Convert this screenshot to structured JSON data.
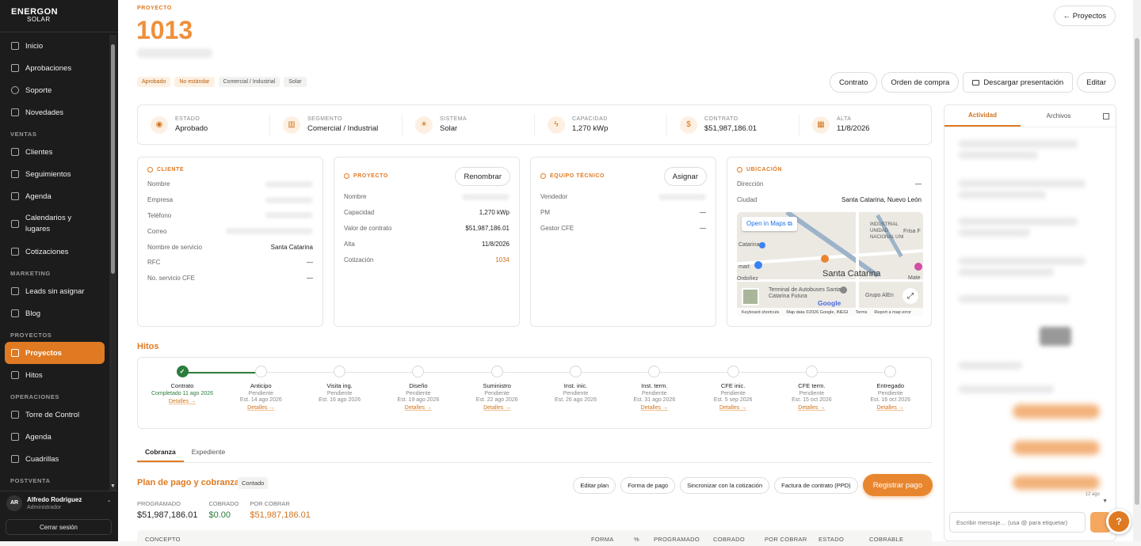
{
  "brand": {
    "name": "ENERGON",
    "sub": "SOLAR"
  },
  "nav": {
    "top": [
      {
        "label": "Inicio",
        "name": "nav-inicio"
      },
      {
        "label": "Aprobaciones",
        "name": "nav-aprobaciones"
      },
      {
        "label": "Soporte",
        "name": "nav-soporte"
      },
      {
        "label": "Novedades",
        "name": "nav-novedades"
      }
    ],
    "sections": {
      "ventas": "VENTAS",
      "marketing": "MARKETING",
      "proyectos": "PROYECTOS",
      "operaciones": "OPERACIONES",
      "postventa": "POSTVENTA"
    },
    "ventas": [
      "Clientes",
      "Seguimientos",
      "Agenda",
      "Calendarios y lugares",
      "Cotizaciones"
    ],
    "marketing": [
      "Leads sin asignar",
      "Blog"
    ],
    "proyectos": [
      "Proyectos",
      "Hitos"
    ],
    "operaciones": [
      "Torre de Control",
      "Agenda",
      "Cuadrillas"
    ]
  },
  "user": {
    "initials": "AR",
    "name": "Alfredo Rodriguez",
    "role": "Administrador",
    "logout": "Cerrar sesión"
  },
  "project": {
    "kicker": "PROYECTO",
    "id": "1013",
    "back": "← Proyectos",
    "tags": [
      "Aprobado",
      "No estándar",
      "Comercial / Industrial",
      "Solar"
    ],
    "actions": {
      "contrato": "Contrato",
      "orden": "Orden de compra",
      "descargar": "Descargar presentación",
      "editar": "Editar"
    }
  },
  "summary": [
    {
      "label": "ESTADO",
      "value": "Aprobado",
      "icon": "circle-icon"
    },
    {
      "label": "SEGMENTO",
      "value": "Comercial / Industrial",
      "icon": "building-icon"
    },
    {
      "label": "SISTEMA",
      "value": "Solar",
      "icon": "sun-icon"
    },
    {
      "label": "CAPACIDAD",
      "value": "1,270 kWp",
      "icon": "bolt-icon"
    },
    {
      "label": "CONTRATO",
      "value": "$51,987,186.01",
      "icon": "dollar-icon"
    },
    {
      "label": "ALTA",
      "value": "11/8/2026",
      "icon": "calendar-icon"
    }
  ],
  "cliente": {
    "kicker": "CLIENTE",
    "rows": [
      {
        "label": "Nombre",
        "value": ""
      },
      {
        "label": "Empresa",
        "value": ""
      },
      {
        "label": "Teléfono",
        "value": ""
      },
      {
        "label": "Correo",
        "value": ""
      },
      {
        "label": "Nombre de servicio",
        "value": "Santa Catarina"
      },
      {
        "label": "RFC",
        "value": "—"
      },
      {
        "label": "No. servicio CFE",
        "value": "—"
      }
    ]
  },
  "proyecto_card": {
    "kicker": "PROYECTO",
    "button": "Renombrar",
    "rows": [
      {
        "label": "Nombre",
        "value": ""
      },
      {
        "label": "Capacidad",
        "value": "1,270 kWp"
      },
      {
        "label": "Valor de contrato",
        "value": "$51,987,186.01"
      },
      {
        "label": "Alta",
        "value": "11/8/2026"
      },
      {
        "label": "Cotización",
        "value": "1034"
      }
    ]
  },
  "equipo": {
    "kicker": "EQUIPO TÉCNICO",
    "button": "Asignar",
    "rows": [
      {
        "label": "Vendedor",
        "value": ""
      },
      {
        "label": "PM",
        "value": "—"
      },
      {
        "label": "Gestor CFE",
        "value": "—"
      }
    ]
  },
  "ubicacion": {
    "kicker": "UBICACIÓN",
    "rows": [
      {
        "label": "Dirección",
        "value": "—"
      },
      {
        "label": "Ciudad",
        "value": "Santa Catarina, Nuevo León"
      }
    ],
    "map": {
      "open": "Open in Maps",
      "city": "Santa Catarina",
      "labels": [
        "INDUSTRIAL UNIDAD NACIONAL UNI",
        "Frisa F",
        "Catarina",
        "mart",
        "Ordoñez",
        "Terminal de Autobuses Santa Catarina Futura",
        "Grupo AlEn",
        "Mate"
      ],
      "google": "Google",
      "footer": [
        "Keyboard shortcuts",
        "Map data ©2026 Google, INEGI",
        "Terms",
        "Report a map error"
      ]
    }
  },
  "hitos": {
    "title": "Hitos",
    "steps": [
      {
        "name": "Contrato",
        "status": "Completado 11 ago 2026",
        "date": "",
        "link": "Detalles →",
        "done": true
      },
      {
        "name": "Anticipo",
        "status": "Pendiente",
        "date": "Est. 14 ago 2026",
        "link": "Detalles →"
      },
      {
        "name": "Visita ing.",
        "status": "Pendiente",
        "date": "Est. 16 ago 2026",
        "link": ""
      },
      {
        "name": "Diseño",
        "status": "Pendiente",
        "date": "Est. 19 ago 2026",
        "link": "Detalles →"
      },
      {
        "name": "Suministro",
        "status": "Pendiente",
        "date": "Est. 22 ago 2026",
        "link": "Detalles →"
      },
      {
        "name": "Inst. inic.",
        "status": "Pendiente",
        "date": "Est. 26 ago 2026",
        "link": ""
      },
      {
        "name": "Inst. term.",
        "status": "Pendiente",
        "date": "Est. 31 ago 2026",
        "link": "Detalles →"
      },
      {
        "name": "CFE inic.",
        "status": "Pendiente",
        "date": "Est. 5 sep 2026",
        "link": "Detalles →"
      },
      {
        "name": "CFE term.",
        "status": "Pendiente",
        "date": "Est. 15 oct 2026",
        "link": "Detalles →"
      },
      {
        "name": "Entregado",
        "status": "Pendiente",
        "date": "Est. 16 oct 2026",
        "link": "Detalles →"
      }
    ]
  },
  "tabs": [
    "Cobranza",
    "Expediente"
  ],
  "plan": {
    "title": "Plan de pago y cobranza",
    "badge": "Contado",
    "actions": [
      "Editar plan",
      "Forma de pago",
      "Sincronizar con la cotización",
      "Factura de contrato (PPD)"
    ],
    "primary": "Registrar pago",
    "totals": [
      {
        "label": "PROGRAMADO",
        "value": "$51,987,186.01"
      },
      {
        "label": "COBRADO",
        "value": "$0.00"
      },
      {
        "label": "POR COBRAR",
        "value": "$51,987,186.01"
      }
    ],
    "columns": [
      "CONCEPTO",
      "FORMA",
      "%",
      "PROGRAMADO",
      "COBRADO",
      "POR COBRAR",
      "ESTADO",
      "COBRABLE"
    ]
  },
  "activity": {
    "tabs": [
      "Actividad",
      "Archivos"
    ],
    "placeholder": "Escribir mensaje… (usa @ para etiquetar)",
    "timestamp": "12 ago"
  },
  "colors": {
    "accent": "#e07a22",
    "success": "#2d7d3c",
    "sidebar": "#1c1c1c"
  }
}
